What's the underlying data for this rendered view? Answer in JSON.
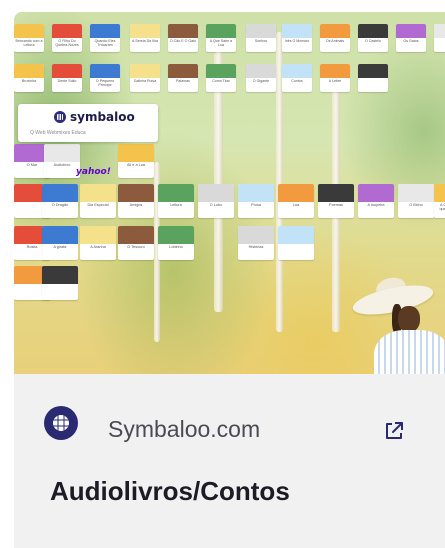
{
  "preview": {
    "logo_text": "symbaloo",
    "logo_tabs": "Q Web   Webmixes   Educa",
    "yahoo_label": "yahoo!",
    "tile_captions": [
      "Brincando com a Leitura",
      "O Filho Do Quebra-Nozes",
      "Quando Eles Trocaram",
      "A Sereia Da Ilha",
      "O Cão E O Gato",
      "A Que Sabe a Lua",
      "Sonhos",
      "Inês O Monstro",
      "Os Animais",
      "O Castelo",
      "Os Gatos",
      "",
      "Bruxinha",
      "Dente Solto",
      "O Pequeno Príncipe",
      "Galinha Ruiva",
      "Palavras",
      "Como Tirar",
      "O Gigante",
      "Contos",
      "A Lebre",
      "",
      "O Mar",
      "Audiolivro",
      "Ali e a Lua",
      "",
      "O Dragão",
      "Dia Especial",
      "Amigos",
      "Leitura",
      "O Lobo",
      "Prosa",
      "Lua",
      "Poemas",
      "A toupeira",
      "O Bicho",
      "A Cadeira que queria ser sofá",
      "Rosita",
      "A girafa",
      "A Aranha",
      "O Tesouro",
      "Lobinho",
      "Histórias"
    ]
  },
  "source": {
    "name": "Symbaloo.com",
    "icon": "symbaloo-logo-icon",
    "external_icon": "external-link-icon"
  },
  "title": "Audiolivros/Contos",
  "colors": {
    "source_icon_bg": "#2a2a72",
    "title": "#1c1c26",
    "card_bg": "#f1f1f1"
  }
}
